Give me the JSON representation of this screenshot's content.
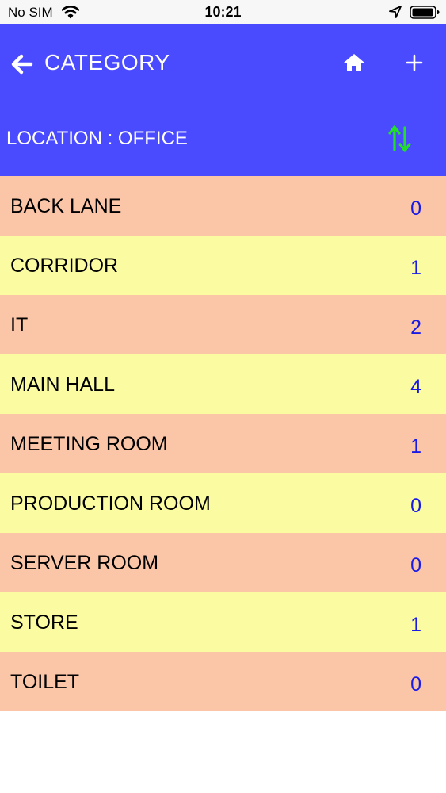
{
  "status_bar": {
    "carrier": "No SIM",
    "time": "10:21"
  },
  "header": {
    "title": "CATEGORY",
    "location_label": "LOCATION : OFFICE",
    "colors": {
      "background": "#4a4bff",
      "sort_icon": "#22e02a"
    }
  },
  "categories": [
    {
      "name": "BACK LANE",
      "count": "0"
    },
    {
      "name": "CORRIDOR",
      "count": "1"
    },
    {
      "name": "IT",
      "count": "2"
    },
    {
      "name": "MAIN HALL",
      "count": "4"
    },
    {
      "name": "MEETING ROOM",
      "count": "1"
    },
    {
      "name": "PRODUCTION ROOM",
      "count": "0"
    },
    {
      "name": "SERVER ROOM",
      "count": "0"
    },
    {
      "name": "STORE",
      "count": "1"
    },
    {
      "name": "TOILET",
      "count": "0"
    }
  ],
  "row_colors": [
    "#fbc6a8",
    "#fbfba2"
  ],
  "icons": [
    "wifi-icon",
    "location-arrow-icon",
    "battery-icon",
    "back-arrow-icon",
    "home-icon",
    "plus-icon",
    "sort-icon"
  ]
}
